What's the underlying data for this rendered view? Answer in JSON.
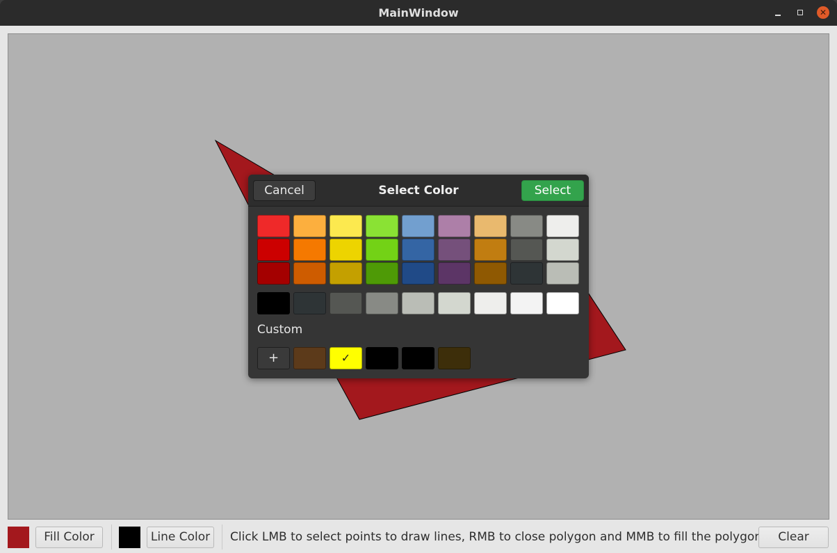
{
  "window": {
    "title": "MainWindow",
    "minimize_glyph": "",
    "maximize_glyph": "",
    "close_glyph": "✕"
  },
  "canvas": {
    "background": "#b1b1b1",
    "polygon_fill": "#a3181d",
    "polygon_stroke": "#000000"
  },
  "toolbar": {
    "fill_swatch_color": "#a3181d",
    "fill_button_label": "Fill Color",
    "line_swatch_color": "#000000",
    "line_button_label": "Line Color",
    "status_text": "Click LMB to select points to draw lines, RMB to close polygon and MMB to fill the polygon.",
    "clear_button_label": "Clear"
  },
  "dialog": {
    "title": "Select Color",
    "cancel_label": "Cancel",
    "select_label": "Select",
    "palette": [
      [
        "#ef2929",
        "#fcaf3e",
        "#fce94f",
        "#8ae234",
        "#729fcf",
        "#ad7fa8",
        "#e9b96e",
        "#888a85",
        "#eeeeec"
      ],
      [
        "#cc0000",
        "#f57900",
        "#edd400",
        "#73d216",
        "#3465a4",
        "#75507b",
        "#c17d11",
        "#555753",
        "#d3d7cf"
      ],
      [
        "#a40000",
        "#ce5c00",
        "#c4a000",
        "#4e9a06",
        "#204a87",
        "#5c3566",
        "#8f5902",
        "#2e3436",
        "#babdb6"
      ]
    ],
    "grays": [
      "#000000",
      "#2e3436",
      "#555753",
      "#888a85",
      "#babdb6",
      "#d3d7cf",
      "#eeeeec",
      "#f3f3f3",
      "#ffffff"
    ],
    "custom_label": "Custom",
    "add_glyph": "+",
    "check_glyph": "✓",
    "custom_colors": [
      "#5c3a1a",
      "#ffff00",
      "#000000",
      "#000000",
      "#3d2e0a"
    ],
    "selected_custom_index": 1
  }
}
